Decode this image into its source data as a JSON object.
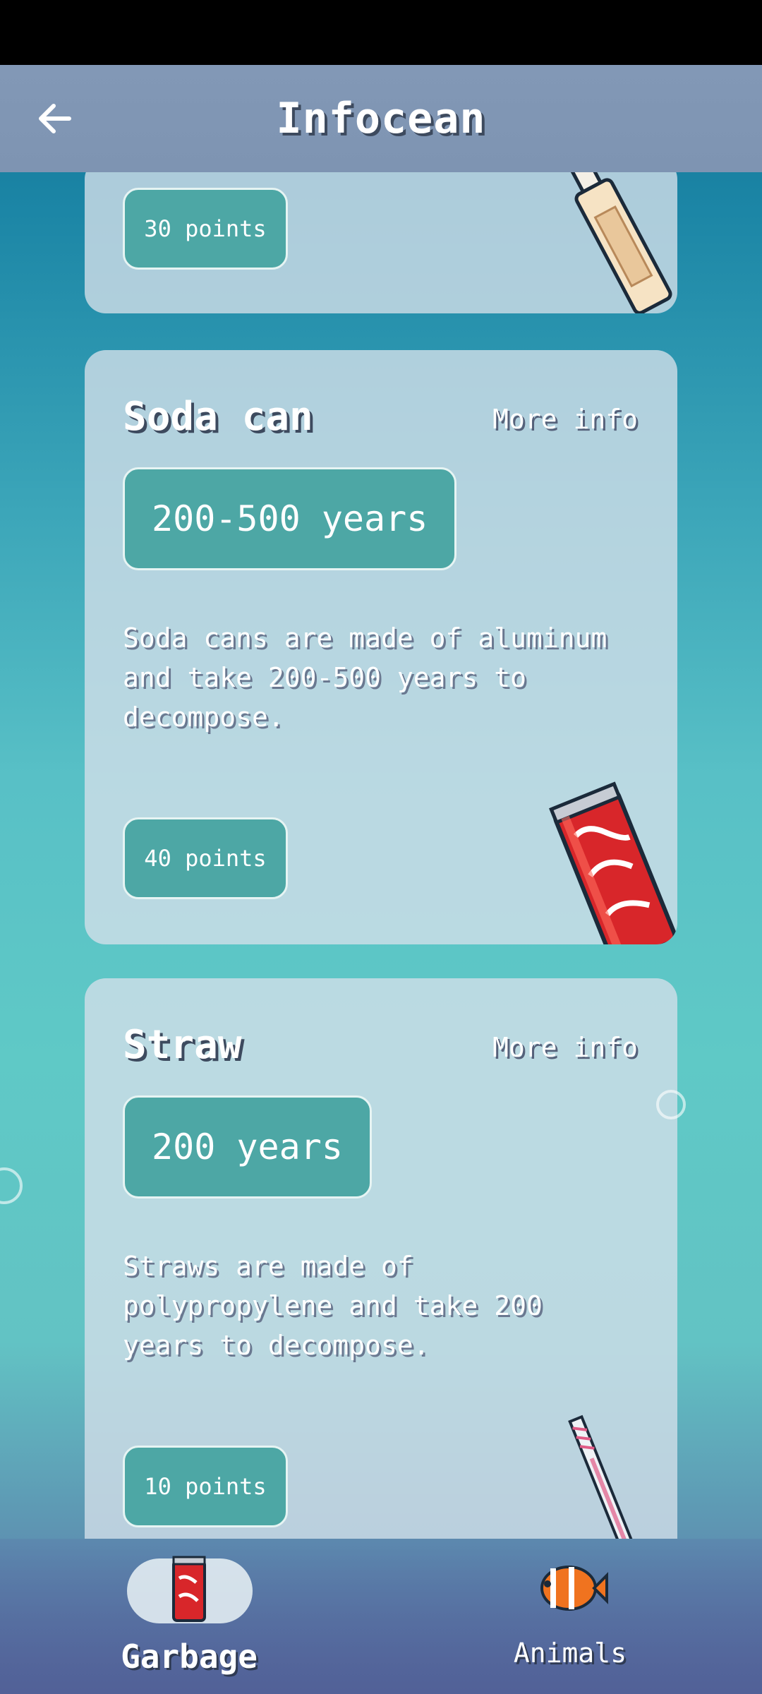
{
  "app_bar": {
    "title": "Infocean"
  },
  "cards": [
    {
      "title": "",
      "more_info": "",
      "years": "",
      "description": "",
      "points": "30 points"
    },
    {
      "title": "Soda can",
      "more_info": "More info",
      "years": "200-500 years",
      "description": "Soda cans are made of aluminum and take 200-500 years to decompose.",
      "points": "40 points"
    },
    {
      "title": "Straw",
      "more_info": "More info",
      "years": "200 years",
      "description": "Straws are made of polypropylene and take 200 years to decompose.",
      "points": "10 points"
    }
  ],
  "bottom_nav": {
    "items": [
      {
        "label": "Garbage",
        "selected": true,
        "icon": "soda-can-icon"
      },
      {
        "label": "Animals",
        "selected": false,
        "icon": "clownfish-icon"
      }
    ]
  },
  "colors": {
    "badge": "#4da7a5",
    "card": "#d2dee8",
    "app_bar": "#8298b6"
  }
}
